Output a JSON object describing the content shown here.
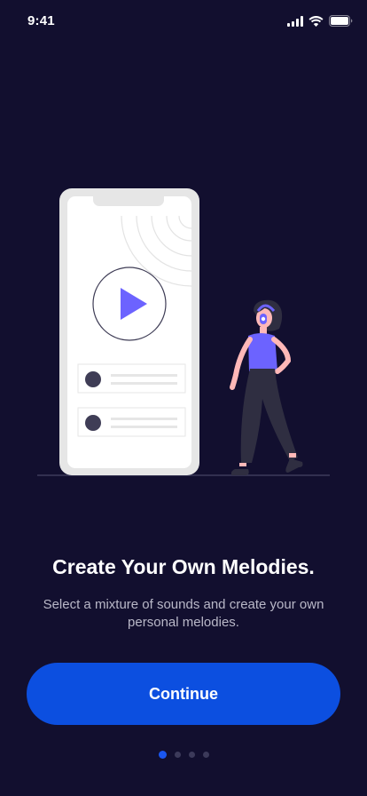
{
  "status_bar": {
    "time": "9:41",
    "icons": [
      "cellular-signal-icon",
      "wifi-icon",
      "battery-icon"
    ]
  },
  "illustration": {
    "name": "person-with-headphones-and-phone-music-player",
    "accent_color": "#6c63ff"
  },
  "onboarding": {
    "title": "Create Your Own Melodies.",
    "subtitle": "Select a mixture of sounds and create your own personal melodies.",
    "continue_label": "Continue"
  },
  "pagination": {
    "total": 4,
    "current": 1
  },
  "colors": {
    "background": "#120f2f",
    "primary_button": "#0c4fe0",
    "accent": "#6c63ff",
    "text_muted": "#b9b8c8"
  }
}
